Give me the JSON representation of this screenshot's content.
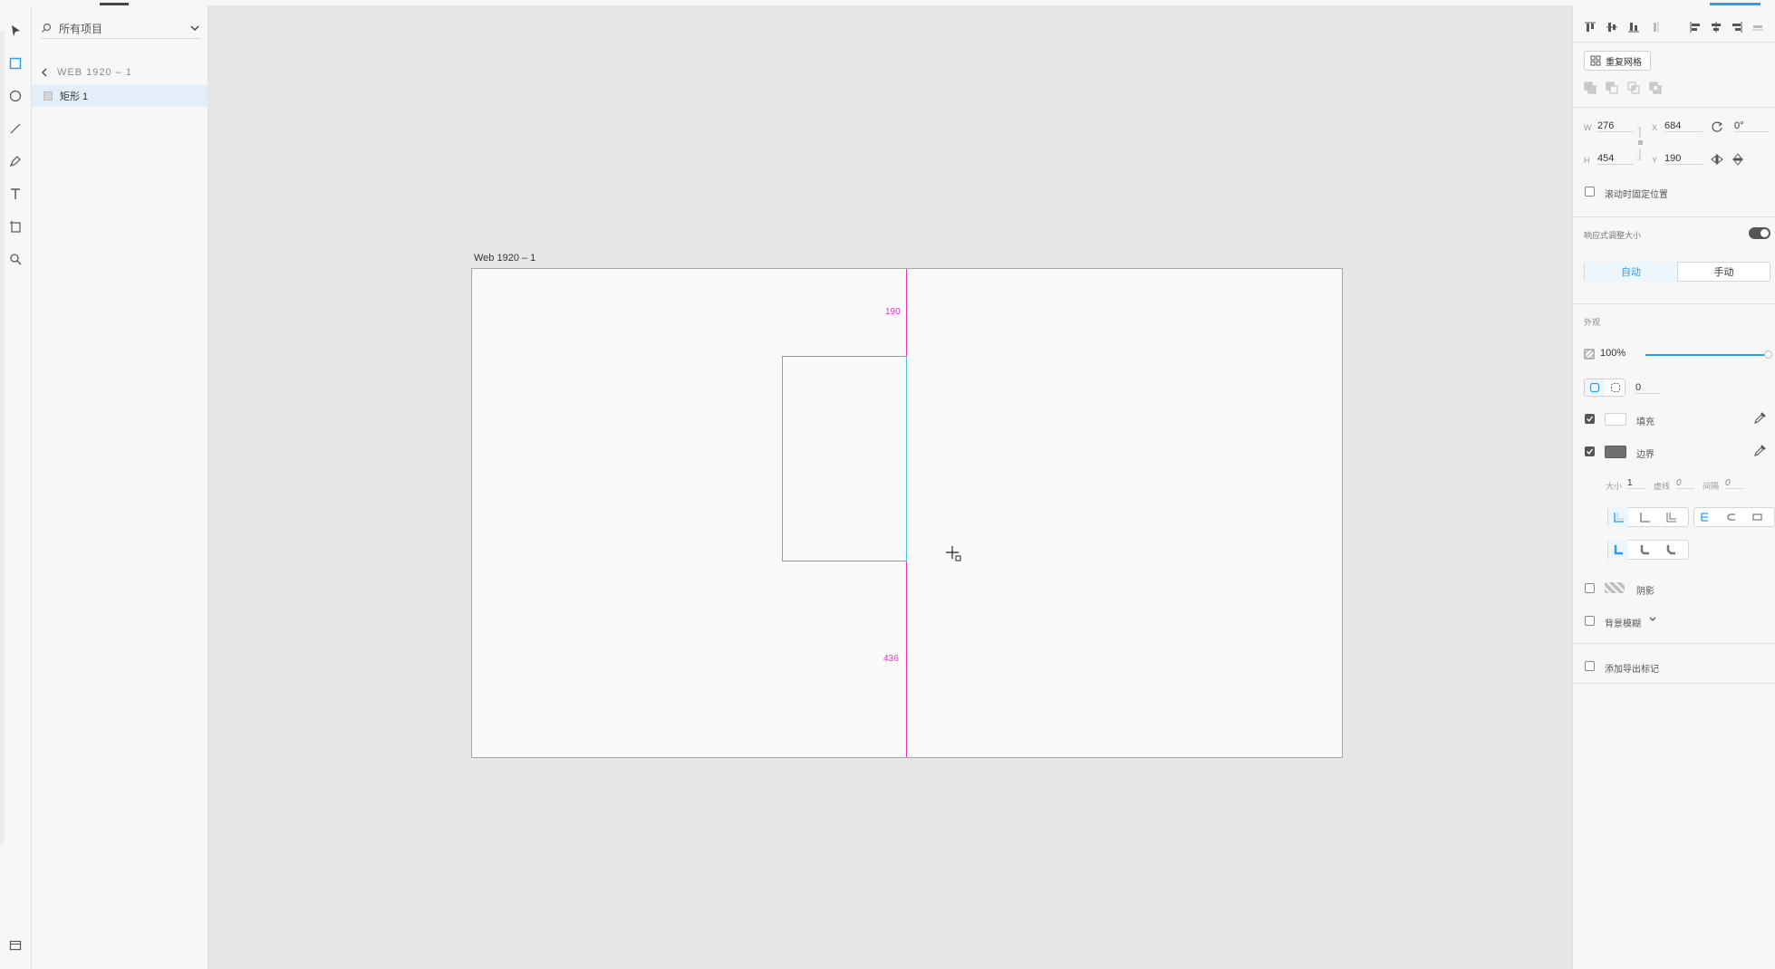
{
  "layers_panel": {
    "search_label": "所有项目",
    "breadcrumb": "WEB 1920 – 1",
    "layer_name": "矩形 1"
  },
  "canvas": {
    "artboard_title": "Web 1920 – 1",
    "dist_top": "190",
    "dist_bottom": "436"
  },
  "props": {
    "repeat_grid": "重复网格",
    "w_label": "W",
    "w_value": "276",
    "h_label": "H",
    "h_value": "454",
    "x_label": "X",
    "x_value": "684",
    "y_label": "Y",
    "y_value": "190",
    "rotation": "0°",
    "fix_on_scroll": "滚动时固定位置",
    "responsive_resize": "响应式调整大小",
    "responsive_on": true,
    "auto_label": "自动",
    "manual_label": "手动",
    "appearance": "外观",
    "opacity": "100%",
    "opacity_fraction": 1.0,
    "corner_radius": "0",
    "fill_label": "填充",
    "fill_checked": true,
    "fill_color": "#ffffff",
    "border_label": "边界",
    "border_checked": true,
    "border_color": "#707070",
    "size_label": "大小",
    "size_value": "1",
    "dash_label": "虚线",
    "dash_value": "0",
    "gap_label": "间隔",
    "gap_value": "0",
    "shadow_label": "阴影",
    "bg_blur_label": "背景模糊",
    "export_label": "添加导出标记"
  },
  "colors": {
    "accent": "#2d9bf0",
    "guide_magenta": "#e52fd3",
    "guide_cyan": "#3fc8e8"
  }
}
